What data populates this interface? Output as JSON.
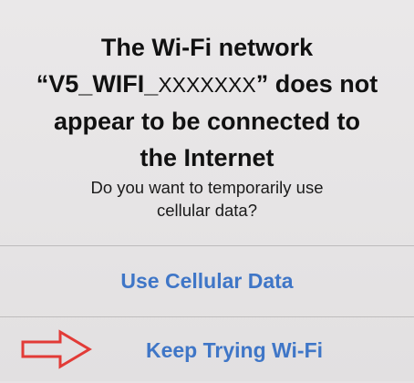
{
  "alert": {
    "title_lines": [
      "The Wi-Fi network",
      "“V5_WIFI_",
      "XXXXXXX",
      "” does not",
      "appear to be connected to",
      "the Internet"
    ],
    "message_lines": [
      "Do you want to temporarily use",
      "cellular data?"
    ],
    "actions": [
      {
        "label": "Use Cellular Data"
      },
      {
        "label": "Keep Trying Wi-Fi"
      }
    ]
  },
  "annotation": {
    "icon": "arrow-right-icon",
    "color": "#e23b37"
  },
  "colors": {
    "action_blue": "#3f76c7",
    "background": "#e7e4e6",
    "divider": "#bdbbbc"
  }
}
